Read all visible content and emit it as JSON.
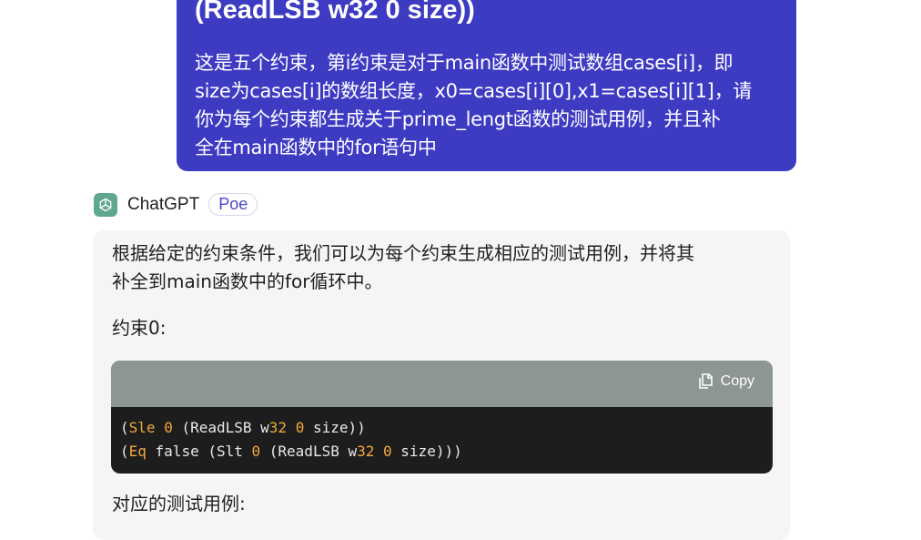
{
  "user_message": {
    "heading": "(ReadLSB w32 0 size))",
    "lines": [
      "这是五个约束，第i约束是对于main函数中测试数组cases[i]，即",
      "size为cases[i]的数组长度，x0=cases[i][0],x1=cases[i][1]，请",
      "你为每个约束都生成关于prime_lengt函数的测试用例，并且补",
      "全在main函数中的for语句中"
    ]
  },
  "bot": {
    "name": "ChatGPT",
    "badge": "Poe",
    "icon": "openai-logo-icon"
  },
  "response": {
    "intro_lines": [
      "根据给定的约束条件，我们可以为每个约束生成相应的测试用例，并将其",
      "补全到main函数中的for循环中。"
    ],
    "constraint_label": "约束0:",
    "code": {
      "copy_label": "Copy",
      "line1": {
        "p1": "(",
        "kw": "Sle",
        "p2": " ",
        "n1": "0",
        "p3": " (ReadLSB w",
        "n2": "32",
        "p4": " ",
        "n3": "0",
        "p5": " size))"
      },
      "line2": {
        "p1": "(",
        "kw": "Eq",
        "p2": " false (Slt ",
        "n1": "0",
        "p3": " (ReadLSB w",
        "n2": "32",
        "p4": " ",
        "n3": "0",
        "p5": " size)))"
      }
    },
    "test_cases_label": "对应的测试用例:"
  },
  "colors": {
    "user_bubble": "#3d3bc2",
    "bot_bubble": "#f5f5f5",
    "code_header": "#8e9595",
    "code_bg": "#1d1d1d",
    "keyword": "#f2a93b"
  }
}
